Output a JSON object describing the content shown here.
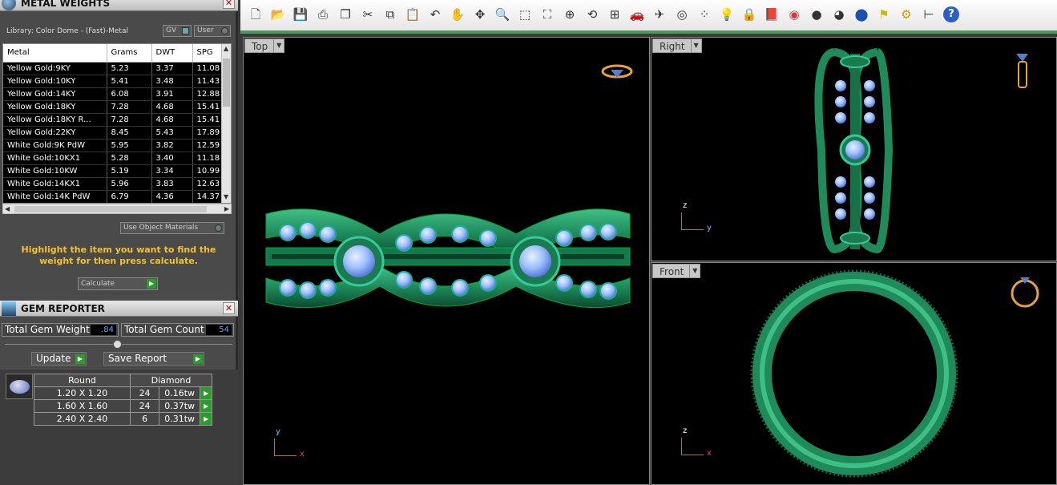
{
  "metal_weights": {
    "title": "METAL WEIGHTS",
    "library": "Library: Color Dome - (Fast)-Metal",
    "gv_label": "GV",
    "user_label": "User",
    "columns": [
      "Metal",
      "Grams",
      "DWT",
      "SPG"
    ],
    "rows": [
      [
        "Yellow Gold:9KY",
        "5.23",
        "3.37",
        "11.08"
      ],
      [
        "Yellow Gold:10KY",
        "5.41",
        "3.48",
        "11.43"
      ],
      [
        "Yellow Gold:14KY",
        "6.08",
        "3.91",
        "12.88"
      ],
      [
        "Yellow Gold:18KY",
        "7.28",
        "4.68",
        "15.41"
      ],
      [
        "Yellow Gold:18KY R...",
        "7.28",
        "4.68",
        "15.41"
      ],
      [
        "Yellow Gold:22KY",
        "8.45",
        "5.43",
        "17.89"
      ],
      [
        "White Gold:9K PdW",
        "5.95",
        "3.82",
        "12.59"
      ],
      [
        "White Gold:10KX1",
        "5.28",
        "3.40",
        "11.18"
      ],
      [
        "White Gold:10KW",
        "5.19",
        "3.34",
        "10.99"
      ],
      [
        "White Gold:14KX1",
        "5.96",
        "3.83",
        "12.63"
      ],
      [
        "White Gold:14K PdW",
        "6.79",
        "4.36",
        "14.37"
      ]
    ],
    "use_object_materials": "Use Object Materials",
    "hint": "Highlight the item you want to find the weight for then press calculate.",
    "calculate": "Calculate"
  },
  "gem_reporter": {
    "title": "GEM REPORTER",
    "total_weight_label": "Total Gem Weight",
    "total_weight_value": ".84",
    "total_count_label": "Total Gem Count",
    "total_count_value": "54",
    "update": "Update",
    "save_report": "Save Report",
    "shape": "Round",
    "material": "Diamond",
    "gems": [
      {
        "size": "1.20 X 1.20",
        "count": "24",
        "weight": "0.16tw"
      },
      {
        "size": "1.60 X 1.60",
        "count": "24",
        "weight": "0.37tw"
      },
      {
        "size": "2.40 X 2.40",
        "count": "6",
        "weight": "0.31tw"
      }
    ]
  },
  "toolbar": {
    "icons": [
      "new-icon",
      "open-icon",
      "save-icon",
      "print-icon",
      "copy-page-icon",
      "cut-icon",
      "copy-icon",
      "paste-icon",
      "undo-icon",
      "pan-hand-icon",
      "move-icon",
      "zoom-icon",
      "zoom-window-icon",
      "zoom-extents-icon",
      "zoom-selected-icon",
      "rotate-view-icon",
      "four-views-icon",
      "car-icon",
      "plane-icon",
      "target-icon",
      "points-icon",
      "light-bulb-icon",
      "lock-icon",
      "book-icon",
      "color-wheel-icon",
      "sphere-gray-icon",
      "sphere-dark-icon",
      "sphere-blue-icon",
      "flag-icon",
      "gear-icon",
      "hierarchy-icon",
      "help-icon"
    ]
  },
  "viewports": {
    "top": {
      "label": "Top",
      "axis1": "y",
      "axis2": "x"
    },
    "right": {
      "label": "Right",
      "axis1": "z",
      "axis2": "y"
    },
    "front": {
      "label": "Front",
      "axis1": "z",
      "axis2": "x"
    }
  },
  "colors": {
    "ring_green": "#1f8a5a",
    "gem_blue": "#9ec1ff",
    "accent_yellow": "#f5c12a",
    "toolbar_green": "#4d9a60"
  }
}
